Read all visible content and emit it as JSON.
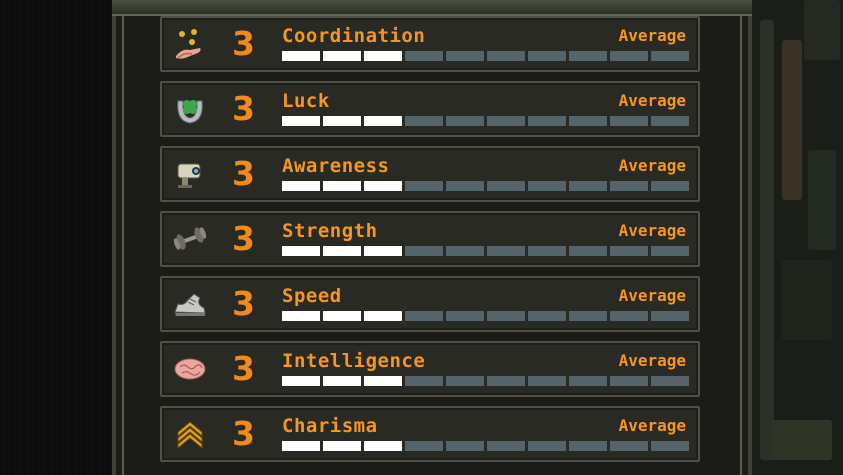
{
  "rating_scale_max": 10,
  "stats": [
    {
      "name": "Coordination",
      "value": "3",
      "level": 3,
      "rating": "Average",
      "icon": "juggling-hand-icon"
    },
    {
      "name": "Luck",
      "value": "3",
      "level": 3,
      "rating": "Average",
      "icon": "horseshoe-clover-icon"
    },
    {
      "name": "Awareness",
      "value": "3",
      "level": 3,
      "rating": "Average",
      "icon": "security-camera-icon"
    },
    {
      "name": "Strength",
      "value": "3",
      "level": 3,
      "rating": "Average",
      "icon": "dumbbell-icon"
    },
    {
      "name": "Speed",
      "value": "3",
      "level": 3,
      "rating": "Average",
      "icon": "sneaker-icon"
    },
    {
      "name": "Intelligence",
      "value": "3",
      "level": 3,
      "rating": "Average",
      "icon": "brain-icon"
    },
    {
      "name": "Charisma",
      "value": "3",
      "level": 3,
      "rating": "Average",
      "icon": "rank-chevron-icon"
    }
  ],
  "colors": {
    "text_orange": "#f5961f",
    "bar_filled": "#ffffff",
    "bar_empty": "#55646a"
  }
}
